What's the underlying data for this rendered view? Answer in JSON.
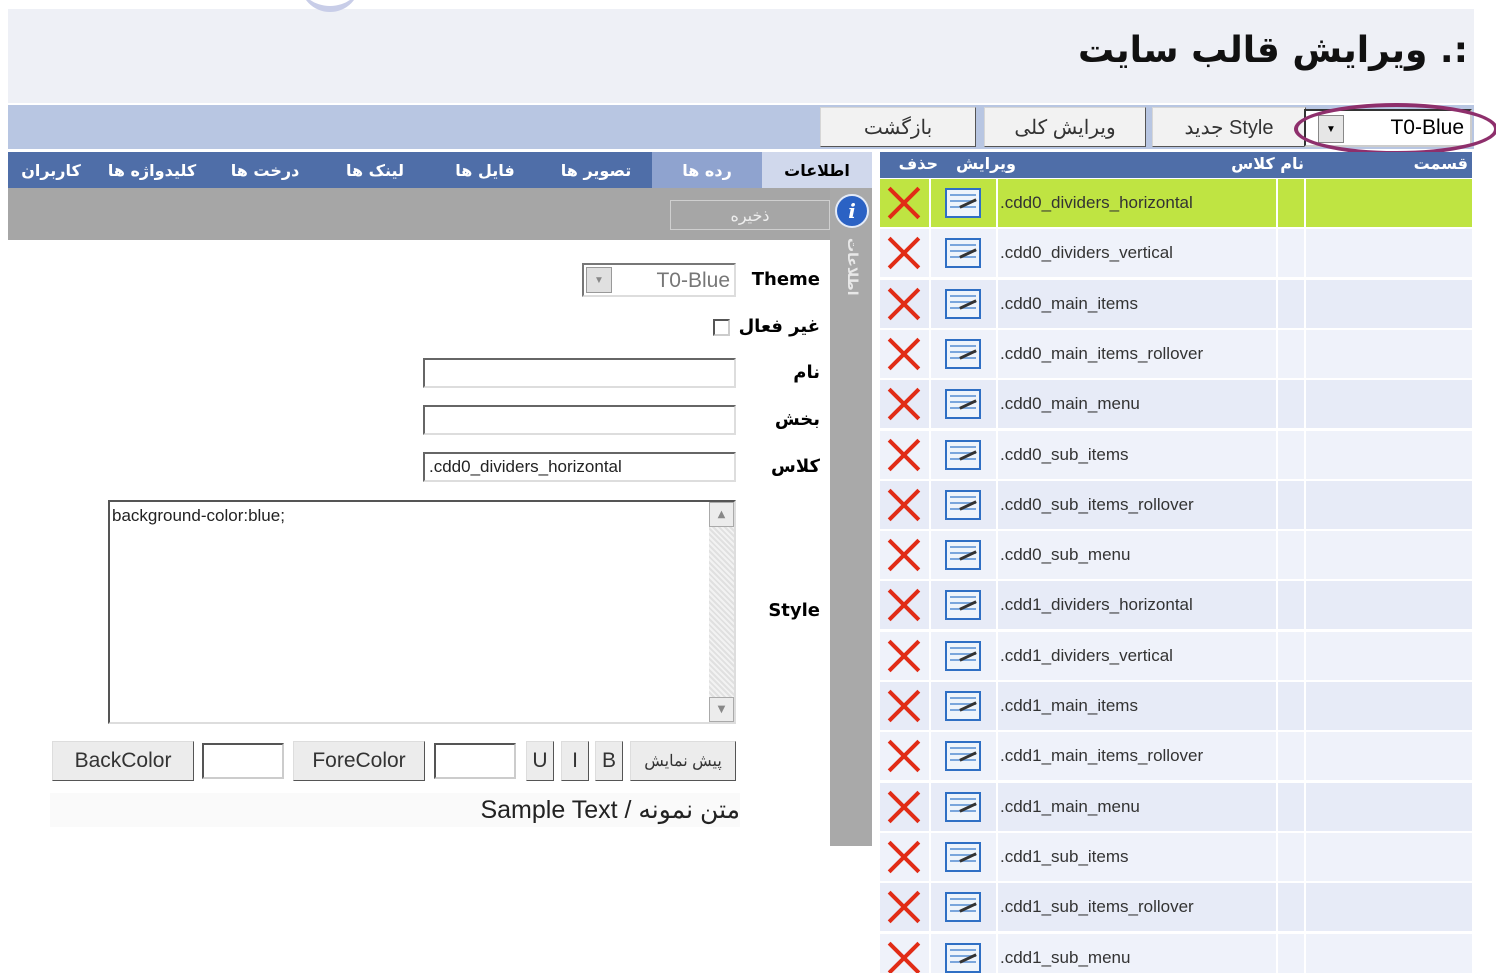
{
  "page": {
    "title": ":. ویرایش قالب سایت"
  },
  "toolbar": {
    "theme_value": "T0-Blue",
    "new_style_label": "Style جدید",
    "edit_all_label": "ویرایش کلی",
    "back_label": "بازگشت"
  },
  "tabs": [
    "اطلاعات",
    "رده ها",
    "تصویر ها",
    "فایل ها",
    "لینک ها",
    "درخت ها",
    "کلیدواژه ها",
    "کاربران"
  ],
  "table": {
    "headers": {
      "section": "قسمت",
      "class_name": "نام کلاس",
      "edit": "ویرایش",
      "delete": "حذف"
    },
    "rows": [
      ".cdd0_dividers_horizontal",
      ".cdd0_dividers_vertical",
      ".cdd0_main_items",
      ".cdd0_main_items_rollover",
      ".cdd0_main_menu",
      ".cdd0_sub_items",
      ".cdd0_sub_items_rollover",
      ".cdd0_sub_menu",
      ".cdd1_dividers_horizontal",
      ".cdd1_dividers_vertical",
      ".cdd1_main_items",
      ".cdd1_main_items_rollover",
      ".cdd1_main_menu",
      ".cdd1_sub_items",
      ".cdd1_sub_items_rollover",
      ".cdd1_sub_menu"
    ],
    "selected_index": 0
  },
  "form": {
    "save_label": "ذخیره",
    "info_vertical_label": "اطلاعات",
    "theme_label": "Theme",
    "theme_value": "T0-Blue",
    "inactive_label": "غیر فعال",
    "name_label": "نام",
    "name_value": "",
    "section_label": "بخش",
    "section_value": "",
    "class_label": "کلاس",
    "class_value": ".cdd0_dividers_horizontal",
    "style_label": "Style",
    "style_value": "background-color:blue;",
    "preview_label": "پیش نمایش",
    "bold_label": "B",
    "italic_label": "I",
    "underline_label": "U",
    "forecolor_label": "ForeColor",
    "backcolor_label": "BackColor",
    "sample_text": "متن نمونه / Sample Text"
  },
  "colors": {
    "selected_row": "#bfe442",
    "row_odd": "#e7ebf7",
    "row_even": "#eff2fa",
    "header_blue": "#4f6ea8",
    "toolbar_blue": "#b8c6e2",
    "delete_red": "#e12c16"
  },
  "icons": {
    "delete": "close-x-icon",
    "edit": "edit-document-icon",
    "info": "info-icon"
  }
}
